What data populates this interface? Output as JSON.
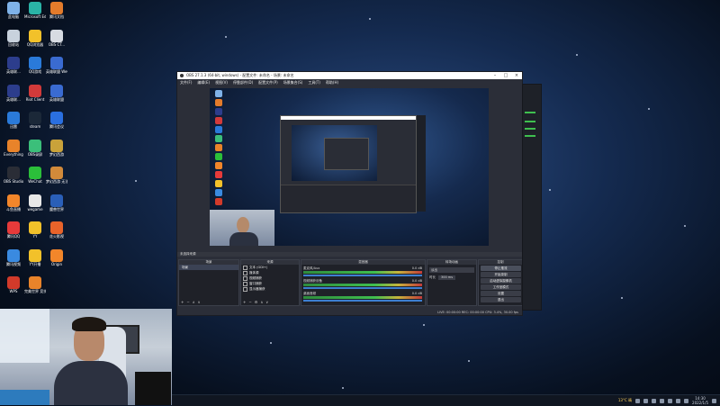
{
  "desktop": {
    "icons": [
      {
        "label": "此电脑",
        "icon": "computer-icon",
        "color": "#7fb2e8"
      },
      {
        "label": "Microsoft Edge",
        "icon": "edge-icon",
        "color": "#2ab3a6"
      },
      {
        "label": "腾讯文档",
        "icon": "tencent-docs-icon",
        "color": "#e37b2b"
      },
      {
        "label": "回收站",
        "icon": "recycle-bin-icon",
        "color": "#c8d2dd"
      },
      {
        "label": "QQ浏览器",
        "icon": "qq-browser-icon",
        "color": "#f2c12a"
      },
      {
        "label": "OBS CT...",
        "icon": "obs-icon",
        "color": "#d7dbe2"
      },
      {
        "label": "英雄联...",
        "icon": "game-icon",
        "color": "#2c3d8c"
      },
      {
        "label": "QQ游戏",
        "icon": "qq-game-icon",
        "color": "#2a7ad9"
      },
      {
        "label": "英雄联盟 WeGame版",
        "icon": "wegame-icon",
        "color": "#3a6bd1"
      },
      {
        "label": "英雄联...",
        "icon": "game-icon",
        "color": "#2c3d8c"
      },
      {
        "label": "Riot Client",
        "icon": "riot-icon",
        "color": "#d23a3a"
      },
      {
        "label": "英雄联盟",
        "icon": "lol-icon",
        "color": "#3a6bd1"
      },
      {
        "label": "迅雷",
        "icon": "xunlei-icon",
        "color": "#2a7ad9"
      },
      {
        "label": "steam",
        "icon": "steam-icon",
        "color": "#1b2838"
      },
      {
        "label": "腾讯会议",
        "icon": "meeting-icon",
        "color": "#2a6fe0"
      },
      {
        "label": "Everything",
        "icon": "everything-icon",
        "color": "#e8832a"
      },
      {
        "label": "OBS录屏",
        "icon": "recorder-icon",
        "color": "#3bbf7a"
      },
      {
        "label": "梦幻西游",
        "icon": "game-icon",
        "color": "#c9a23a"
      },
      {
        "label": "OBS Studio",
        "icon": "obs-studio-icon",
        "color": "#2a2d36"
      },
      {
        "label": "WeChat",
        "icon": "wechat-icon",
        "color": "#2bbf3a"
      },
      {
        "label": "梦幻西游 无法...",
        "icon": "game-icon",
        "color": "#d28a3a"
      },
      {
        "label": "斗鱼直播",
        "icon": "douyu-icon",
        "color": "#f2862a"
      },
      {
        "label": "wegame",
        "icon": "wegame-icon",
        "color": "#e8e8e8"
      },
      {
        "label": "魔兽世界",
        "icon": "wow-icon",
        "color": "#2a5fb8"
      },
      {
        "label": "腾讯QQ",
        "icon": "qq-icon",
        "color": "#e63a3a"
      },
      {
        "label": "YY",
        "icon": "yy-icon",
        "color": "#f2c12a"
      },
      {
        "label": "花火影视",
        "icon": "video-icon",
        "color": "#e8632a"
      },
      {
        "label": "腾讯视频",
        "icon": "tencent-video-icon",
        "color": "#3a8ae0"
      },
      {
        "label": "YY开播",
        "icon": "yy-live-icon",
        "color": "#f2c12a"
      },
      {
        "label": "Origin",
        "icon": "origin-icon",
        "color": "#f2862a"
      },
      {
        "label": "WPS",
        "icon": "wps-icon",
        "color": "#d23a2a"
      },
      {
        "label": "完美世界 竞技平台",
        "icon": "perfect-world-icon",
        "color": "#e8832a"
      }
    ]
  },
  "taskbar": {
    "weather": "13°C 晴",
    "time": "14:30",
    "date": "2022/1/5"
  },
  "obs": {
    "title": "OBS 27.1.3 (64-bit, windows) - 配置文件: 未命名 - 场景: 未命名",
    "menu": [
      "文件(F)",
      "编辑(E)",
      "视图(V)",
      "停靠部件(D)",
      "配置文件(P)",
      "场景集合(S)",
      "工具(T)",
      "帮助(H)"
    ],
    "docks": {
      "scenes": {
        "title": "场景",
        "items": [
          "场景"
        ]
      },
      "sources": {
        "title": "来源",
        "items": [
          "文本 (GDI+)",
          "媒体源",
          "视频捕获",
          "窗口捕获",
          "显示器捕获"
        ]
      },
      "mixer": {
        "title": "混音器",
        "channels": [
          {
            "name": "麦克风/Aux",
            "db": "0.0 dB"
          },
          {
            "name": "视频捕获设备",
            "db": "0.0 dB"
          },
          {
            "name": "桌面音频",
            "db": "0.0 dB"
          }
        ]
      },
      "transitions": {
        "title": "转场动画",
        "type": "淡出",
        "duration_label": "时长",
        "duration": "300 ms"
      },
      "controls": {
        "title": "控制",
        "buttons": [
          "停止推流",
          "开始录制",
          "启动虚拟摄像机",
          "工作室模式",
          "设置",
          "退出"
        ]
      }
    },
    "status": "LIVE: 00:00:00  REC: 00:00:00  CPU: 3.4%, 30.00 fps",
    "source_info": "未选择来源"
  }
}
